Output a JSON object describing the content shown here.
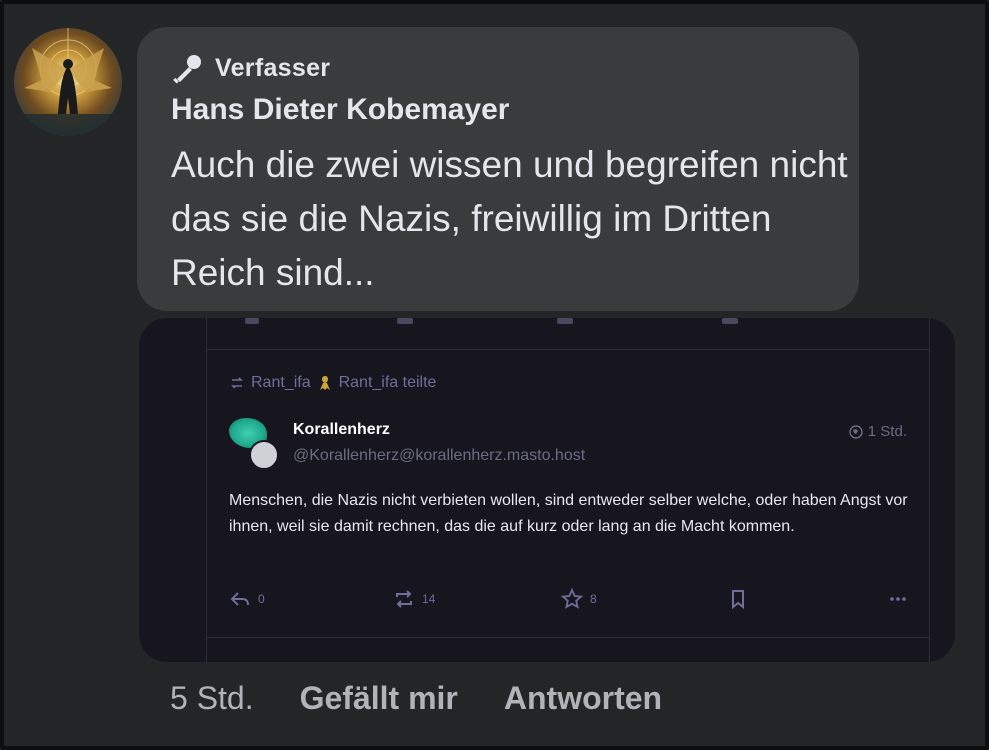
{
  "comment": {
    "author_tag": "Verfasser",
    "author_name": "Hans Dieter Kobemayer",
    "message": "Auch die zwei wissen und begreifen nicht das sie die Nazis, freiwillig im Dritten Reich sind..."
  },
  "embedded_post": {
    "boosted_by": "Rant_ifa",
    "boost_text": "Rant_ifa teilte",
    "display_name": "Korallenherz",
    "handle": "@Korallenherz@korallenherz.masto.host",
    "time": "1 Std.",
    "text": "Menschen, die Nazis nicht verbieten wollen, sind entweder selber welche, oder haben Angst vor ihnen, weil sie damit rechnen, das die auf kurz oder lang an die Macht kommen.",
    "actions": {
      "replies": "0",
      "boosts": "14",
      "favourites": "8"
    }
  },
  "footer": {
    "time": "5 Std.",
    "like_label": "Gefällt mir",
    "reply_label": "Antworten"
  },
  "colors": {
    "background": "#232526",
    "bubble": "#3a3b3c",
    "embedded_bg": "#17161f",
    "accent_text": "#6d6e9a"
  },
  "icons": {
    "author_badge": "microphone-icon",
    "boost": "boost-icon",
    "reply": "reply-icon",
    "favourite": "star-icon",
    "bookmark": "bookmark-icon",
    "more": "more-icon",
    "visibility": "globe-icon"
  }
}
